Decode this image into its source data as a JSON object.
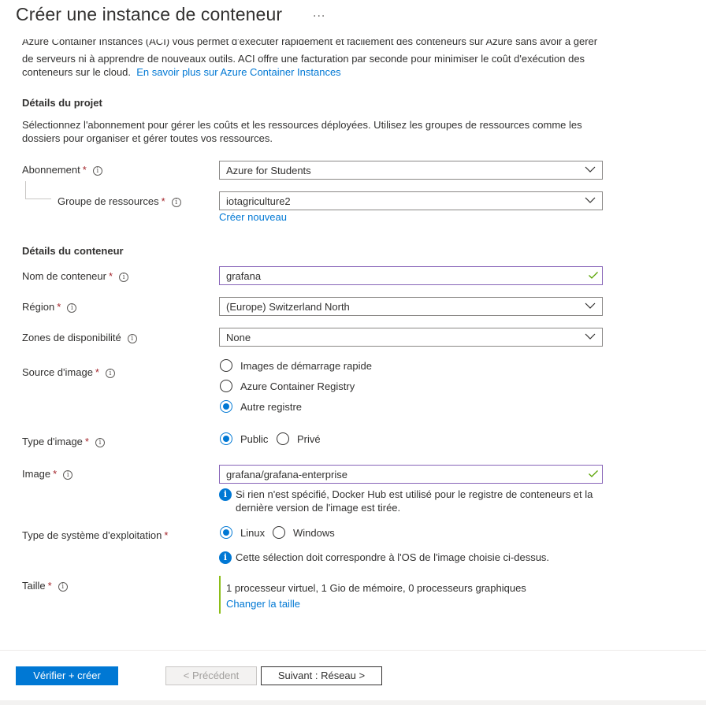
{
  "header": {
    "title": "Créer une instance de conteneur",
    "more_label": "..."
  },
  "intro": {
    "clipped_text": "Azure Container Instances (ACI) vous permet d'exécuter rapidement et facilement des conteneurs sur Azure sans avoir à gérer",
    "text": "de serveurs ni à apprendre de nouveaux outils. ACI offre une facturation par seconde pour minimiser le coût d'exécution des conteneurs sur le cloud.",
    "link": "En savoir plus sur Azure Container Instances"
  },
  "project": {
    "heading": "Détails du projet",
    "description": "Sélectionnez l'abonnement pour gérer les coûts et les ressources déployées. Utilisez les groupes de ressources comme les dossiers pour organiser et gérer toutes vos ressources.",
    "subscription": {
      "label": "Abonnement",
      "value": "Azure for Students"
    },
    "resource_group": {
      "label": "Groupe de ressources",
      "value": "iotagriculture2",
      "create_new": "Créer nouveau"
    }
  },
  "container": {
    "heading": "Détails du conteneur",
    "name": {
      "label": "Nom de conteneur",
      "value": "grafana"
    },
    "region": {
      "label": "Région",
      "value": "(Europe) Switzerland North"
    },
    "zones": {
      "label": "Zones de disponibilité",
      "value": "None"
    },
    "image_source": {
      "label": "Source d'image",
      "options": [
        "Images de démarrage rapide",
        "Azure Container Registry",
        "Autre registre"
      ],
      "selected": "Autre registre"
    },
    "image_type": {
      "label": "Type d'image",
      "options": [
        "Public",
        "Privé"
      ],
      "selected": "Public"
    },
    "image": {
      "label": "Image",
      "value": "grafana/grafana-enterprise",
      "note": "Si rien n'est spécifié, Docker Hub est utilisé pour le registre de conteneurs et la dernière version de l'image est tirée."
    },
    "os_type": {
      "label": "Type de système d'exploitation",
      "options": [
        "Linux",
        "Windows"
      ],
      "selected": "Linux",
      "note": "Cette sélection doit correspondre à l'OS de l'image choisie ci-dessus."
    },
    "size": {
      "label": "Taille",
      "summary": "1 processeur virtuel, 1 Gio de mémoire, 0 processeurs graphiques",
      "change": "Changer la taille"
    }
  },
  "footer": {
    "review_create": "Vérifier + créer",
    "previous": "< Précédent",
    "next": "Suivant : Réseau >"
  },
  "colors": {
    "accent": "#0078d4",
    "required": "#a4262c",
    "valid_check": "#57a300",
    "size_bar": "#8cbd18"
  }
}
